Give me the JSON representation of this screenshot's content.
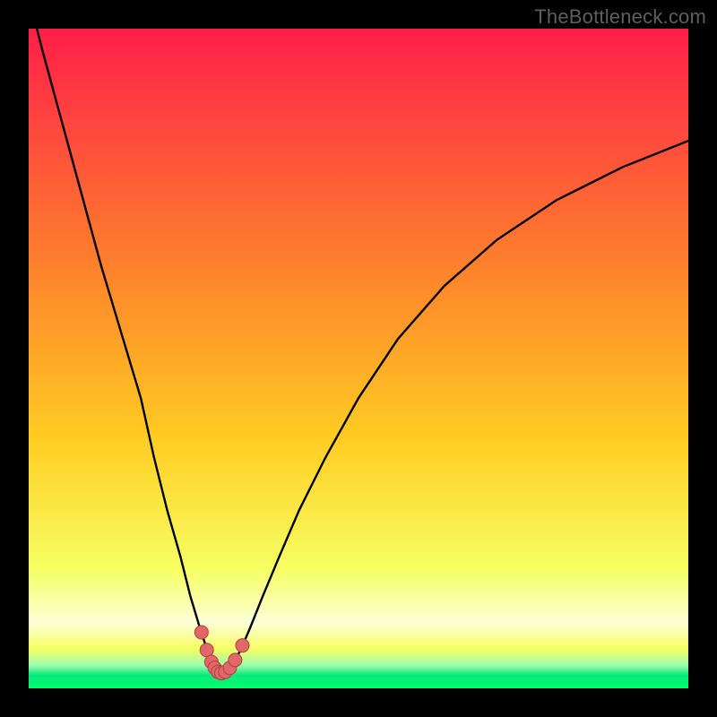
{
  "watermark": "TheBottleneck.com",
  "colors": {
    "page_bg": "#000000",
    "gradient_top": "#ff1e4a",
    "gradient_mid1": "#fe7e2d",
    "gradient_mid2": "#ffcc22",
    "gradient_low": "#f6ff63",
    "gradient_band_pale": "#fcffd8",
    "gradient_band_green": "#09e97a",
    "gradient_bottom": "#00ff6e",
    "curve": "#000000",
    "dot_fill": "#e06868",
    "dot_stroke": "#b23e3e"
  },
  "chart_data": {
    "type": "line",
    "title": "",
    "xlabel": "",
    "ylabel": "",
    "xlim": [
      0,
      100
    ],
    "ylim": [
      0,
      100
    ],
    "series": [
      {
        "name": "bottleneck-curve",
        "x": [
          0,
          2,
          5,
          8,
          11,
          14,
          17,
          19,
          21,
          23,
          24.5,
          26,
          27,
          27.7,
          28.2,
          28.7,
          29.2,
          29.8,
          30.5,
          31.2,
          32.2,
          33.5,
          35.5,
          38,
          41,
          45,
          50,
          56,
          63,
          71,
          80,
          90,
          100
        ],
        "y": [
          105,
          97,
          86,
          75,
          64,
          54,
          44,
          35,
          27,
          20,
          14,
          9,
          6,
          4,
          3,
          2.4,
          2.2,
          2.4,
          3,
          4,
          6,
          9,
          14,
          20,
          27,
          35,
          44,
          53,
          61,
          68,
          74,
          79,
          83
        ]
      }
    ],
    "points": {
      "name": "highlighted-dots",
      "x": [
        26.2,
        27.0,
        27.7,
        28.2,
        28.7,
        29.2,
        29.8,
        30.5,
        31.3,
        32.4
      ],
      "y": [
        8.5,
        5.8,
        4.0,
        3.1,
        2.5,
        2.3,
        2.5,
        3.1,
        4.3,
        6.5
      ]
    }
  }
}
